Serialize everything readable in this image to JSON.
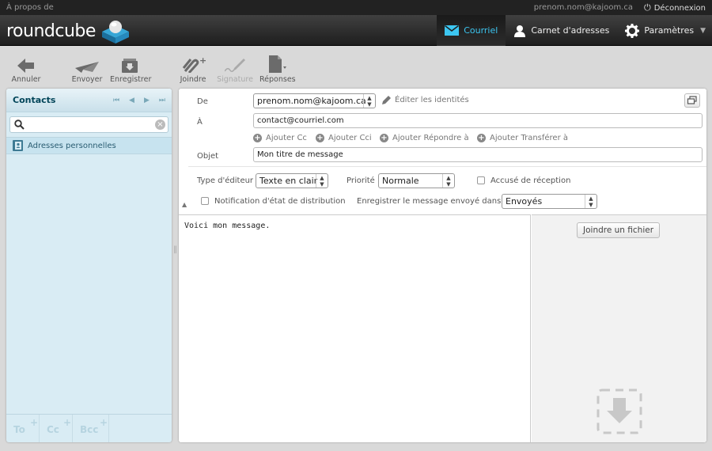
{
  "topline": {
    "about": "À propos de",
    "user": "prenom.nom@kajoom.ca",
    "logout": "Déconnexion"
  },
  "logo": {
    "text": "roundcube"
  },
  "nav": {
    "mail": "Courriel",
    "addressbook": "Carnet d'adresses",
    "settings": "Paramètres"
  },
  "toolbar": {
    "cancel": "Annuler",
    "send": "Envoyer",
    "save": "Enregistrer",
    "attach": "Joindre",
    "signature": "Signature",
    "responses": "Réponses"
  },
  "contacts": {
    "title": "Contacts",
    "search_value": "",
    "addressbook": "Adresses personnelles",
    "recipients": [
      "To",
      "Cc",
      "Bcc"
    ]
  },
  "compose": {
    "from_label": "De",
    "from_value": "prenom.nom@kajoom.ca",
    "edit_identities": "Éditer les identités",
    "to_label": "À",
    "to_value": "contact@courriel.com",
    "add_cc": "Ajouter Cc",
    "add_bcc": "Ajouter Cci",
    "add_replyto": "Ajouter Répondre à",
    "add_followupto": "Ajouter Transférer à",
    "subject_label": "Objet",
    "subject_value": "Mon titre de message",
    "editor_type_label": "Type d'éditeur",
    "editor_type_value": "Texte en clair",
    "priority_label": "Priorité",
    "priority_value": "Normale",
    "receipt_label": "Accusé de réception",
    "dsn_label": "Notification d'état de distribution",
    "store_label": "Enregistrer le message envoyé dans",
    "store_value": "Envoyés",
    "body": "Voici mon message.",
    "attach_button": "Joindre un fichier"
  }
}
